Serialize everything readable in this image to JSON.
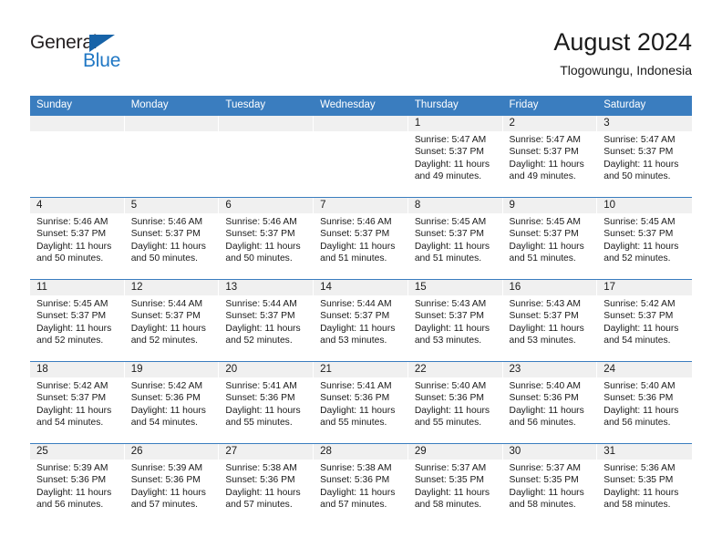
{
  "brand": {
    "name_part1": "General",
    "name_part2": "Blue",
    "triangle_icon": "triangle-icon",
    "accent_color": "#1763a8",
    "text_color": "#231f20"
  },
  "header": {
    "title": "August 2024",
    "subtitle": "Tlogowungu, Indonesia"
  },
  "theme": {
    "header_bar_color": "#3a7dbf",
    "date_band_color": "#f0f0f0",
    "row_divider_color": "#3a7dbf"
  },
  "calendar": {
    "weekday_headers": [
      "Sunday",
      "Monday",
      "Tuesday",
      "Wednesday",
      "Thursday",
      "Friday",
      "Saturday"
    ],
    "weeks": [
      [
        {
          "day": "",
          "empty": true
        },
        {
          "day": "",
          "empty": true
        },
        {
          "day": "",
          "empty": true
        },
        {
          "day": "",
          "empty": true
        },
        {
          "day": "1",
          "sunrise": "Sunrise: 5:47 AM",
          "sunset": "Sunset: 5:37 PM",
          "daylight": "Daylight: 11 hours and 49 minutes."
        },
        {
          "day": "2",
          "sunrise": "Sunrise: 5:47 AM",
          "sunset": "Sunset: 5:37 PM",
          "daylight": "Daylight: 11 hours and 49 minutes."
        },
        {
          "day": "3",
          "sunrise": "Sunrise: 5:47 AM",
          "sunset": "Sunset: 5:37 PM",
          "daylight": "Daylight: 11 hours and 50 minutes."
        }
      ],
      [
        {
          "day": "4",
          "sunrise": "Sunrise: 5:46 AM",
          "sunset": "Sunset: 5:37 PM",
          "daylight": "Daylight: 11 hours and 50 minutes."
        },
        {
          "day": "5",
          "sunrise": "Sunrise: 5:46 AM",
          "sunset": "Sunset: 5:37 PM",
          "daylight": "Daylight: 11 hours and 50 minutes."
        },
        {
          "day": "6",
          "sunrise": "Sunrise: 5:46 AM",
          "sunset": "Sunset: 5:37 PM",
          "daylight": "Daylight: 11 hours and 50 minutes."
        },
        {
          "day": "7",
          "sunrise": "Sunrise: 5:46 AM",
          "sunset": "Sunset: 5:37 PM",
          "daylight": "Daylight: 11 hours and 51 minutes."
        },
        {
          "day": "8",
          "sunrise": "Sunrise: 5:45 AM",
          "sunset": "Sunset: 5:37 PM",
          "daylight": "Daylight: 11 hours and 51 minutes."
        },
        {
          "day": "9",
          "sunrise": "Sunrise: 5:45 AM",
          "sunset": "Sunset: 5:37 PM",
          "daylight": "Daylight: 11 hours and 51 minutes."
        },
        {
          "day": "10",
          "sunrise": "Sunrise: 5:45 AM",
          "sunset": "Sunset: 5:37 PM",
          "daylight": "Daylight: 11 hours and 52 minutes."
        }
      ],
      [
        {
          "day": "11",
          "sunrise": "Sunrise: 5:45 AM",
          "sunset": "Sunset: 5:37 PM",
          "daylight": "Daylight: 11 hours and 52 minutes."
        },
        {
          "day": "12",
          "sunrise": "Sunrise: 5:44 AM",
          "sunset": "Sunset: 5:37 PM",
          "daylight": "Daylight: 11 hours and 52 minutes."
        },
        {
          "day": "13",
          "sunrise": "Sunrise: 5:44 AM",
          "sunset": "Sunset: 5:37 PM",
          "daylight": "Daylight: 11 hours and 52 minutes."
        },
        {
          "day": "14",
          "sunrise": "Sunrise: 5:44 AM",
          "sunset": "Sunset: 5:37 PM",
          "daylight": "Daylight: 11 hours and 53 minutes."
        },
        {
          "day": "15",
          "sunrise": "Sunrise: 5:43 AM",
          "sunset": "Sunset: 5:37 PM",
          "daylight": "Daylight: 11 hours and 53 minutes."
        },
        {
          "day": "16",
          "sunrise": "Sunrise: 5:43 AM",
          "sunset": "Sunset: 5:37 PM",
          "daylight": "Daylight: 11 hours and 53 minutes."
        },
        {
          "day": "17",
          "sunrise": "Sunrise: 5:42 AM",
          "sunset": "Sunset: 5:37 PM",
          "daylight": "Daylight: 11 hours and 54 minutes."
        }
      ],
      [
        {
          "day": "18",
          "sunrise": "Sunrise: 5:42 AM",
          "sunset": "Sunset: 5:37 PM",
          "daylight": "Daylight: 11 hours and 54 minutes."
        },
        {
          "day": "19",
          "sunrise": "Sunrise: 5:42 AM",
          "sunset": "Sunset: 5:36 PM",
          "daylight": "Daylight: 11 hours and 54 minutes."
        },
        {
          "day": "20",
          "sunrise": "Sunrise: 5:41 AM",
          "sunset": "Sunset: 5:36 PM",
          "daylight": "Daylight: 11 hours and 55 minutes."
        },
        {
          "day": "21",
          "sunrise": "Sunrise: 5:41 AM",
          "sunset": "Sunset: 5:36 PM",
          "daylight": "Daylight: 11 hours and 55 minutes."
        },
        {
          "day": "22",
          "sunrise": "Sunrise: 5:40 AM",
          "sunset": "Sunset: 5:36 PM",
          "daylight": "Daylight: 11 hours and 55 minutes."
        },
        {
          "day": "23",
          "sunrise": "Sunrise: 5:40 AM",
          "sunset": "Sunset: 5:36 PM",
          "daylight": "Daylight: 11 hours and 56 minutes."
        },
        {
          "day": "24",
          "sunrise": "Sunrise: 5:40 AM",
          "sunset": "Sunset: 5:36 PM",
          "daylight": "Daylight: 11 hours and 56 minutes."
        }
      ],
      [
        {
          "day": "25",
          "sunrise": "Sunrise: 5:39 AM",
          "sunset": "Sunset: 5:36 PM",
          "daylight": "Daylight: 11 hours and 56 minutes."
        },
        {
          "day": "26",
          "sunrise": "Sunrise: 5:39 AM",
          "sunset": "Sunset: 5:36 PM",
          "daylight": "Daylight: 11 hours and 57 minutes."
        },
        {
          "day": "27",
          "sunrise": "Sunrise: 5:38 AM",
          "sunset": "Sunset: 5:36 PM",
          "daylight": "Daylight: 11 hours and 57 minutes."
        },
        {
          "day": "28",
          "sunrise": "Sunrise: 5:38 AM",
          "sunset": "Sunset: 5:36 PM",
          "daylight": "Daylight: 11 hours and 57 minutes."
        },
        {
          "day": "29",
          "sunrise": "Sunrise: 5:37 AM",
          "sunset": "Sunset: 5:35 PM",
          "daylight": "Daylight: 11 hours and 58 minutes."
        },
        {
          "day": "30",
          "sunrise": "Sunrise: 5:37 AM",
          "sunset": "Sunset: 5:35 PM",
          "daylight": "Daylight: 11 hours and 58 minutes."
        },
        {
          "day": "31",
          "sunrise": "Sunrise: 5:36 AM",
          "sunset": "Sunset: 5:35 PM",
          "daylight": "Daylight: 11 hours and 58 minutes."
        }
      ]
    ]
  }
}
